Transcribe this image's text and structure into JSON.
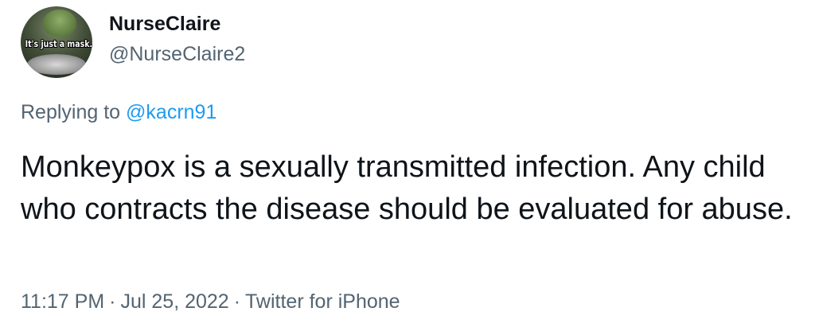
{
  "author": {
    "display_name": "NurseClaire",
    "handle": "@NurseClaire2",
    "avatar_caption": "It's just a mask..."
  },
  "reply": {
    "prefix": "Replying to ",
    "mention": "@kacrn91"
  },
  "tweet": {
    "text": "Monkeypox is a sexually transmitted infection.  Any child who contracts the disease should be evaluated for abuse."
  },
  "meta": {
    "time": "11:17 PM",
    "date": "Jul 25, 2022",
    "source": "Twitter for iPhone",
    "separator": "·"
  },
  "colors": {
    "text_primary": "#0f1419",
    "text_secondary": "#536471",
    "link": "#1d9bf0",
    "background": "#ffffff"
  }
}
